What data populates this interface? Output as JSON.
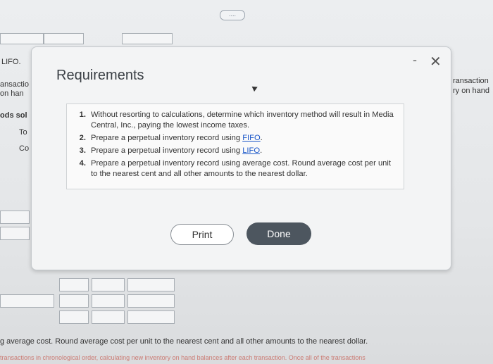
{
  "top_indicator": "....",
  "background": {
    "lifo_label": "LIFO.",
    "transaction_left": "ansactio",
    "on_hand_left": "on han",
    "goods_sold_left": "ods sol",
    "to_label": "To",
    "co_label": "Co",
    "transaction_right": "ransaction",
    "on_hand_right": "ry on hand",
    "footer_line1": "g average cost. Round average cost per unit to the nearest cent and all other amounts to the nearest dollar.",
    "footer_line2": "transactions in chronological order, calculating new inventory on hand balances after each transaction. Once all of the transactions"
  },
  "modal": {
    "title": "Requirements",
    "minimize_label": "-",
    "close_label": "✕",
    "requirements": [
      {
        "num": "1.",
        "text": "Without resorting to calculations, determine which inventory method will result in Media Central, Inc., paying the lowest income taxes."
      },
      {
        "num": "2.",
        "text_before": "Prepare a perpetual inventory record using ",
        "link": "FIFO",
        "text_after": "."
      },
      {
        "num": "3.",
        "text_before": "Prepare a perpetual inventory record using ",
        "link": "LIFO",
        "text_after": "."
      },
      {
        "num": "4.",
        "text": "Prepare a perpetual inventory record using average cost. Round average cost per unit to the nearest cent and all other amounts to the nearest dollar."
      }
    ],
    "print_label": "Print",
    "done_label": "Done"
  }
}
